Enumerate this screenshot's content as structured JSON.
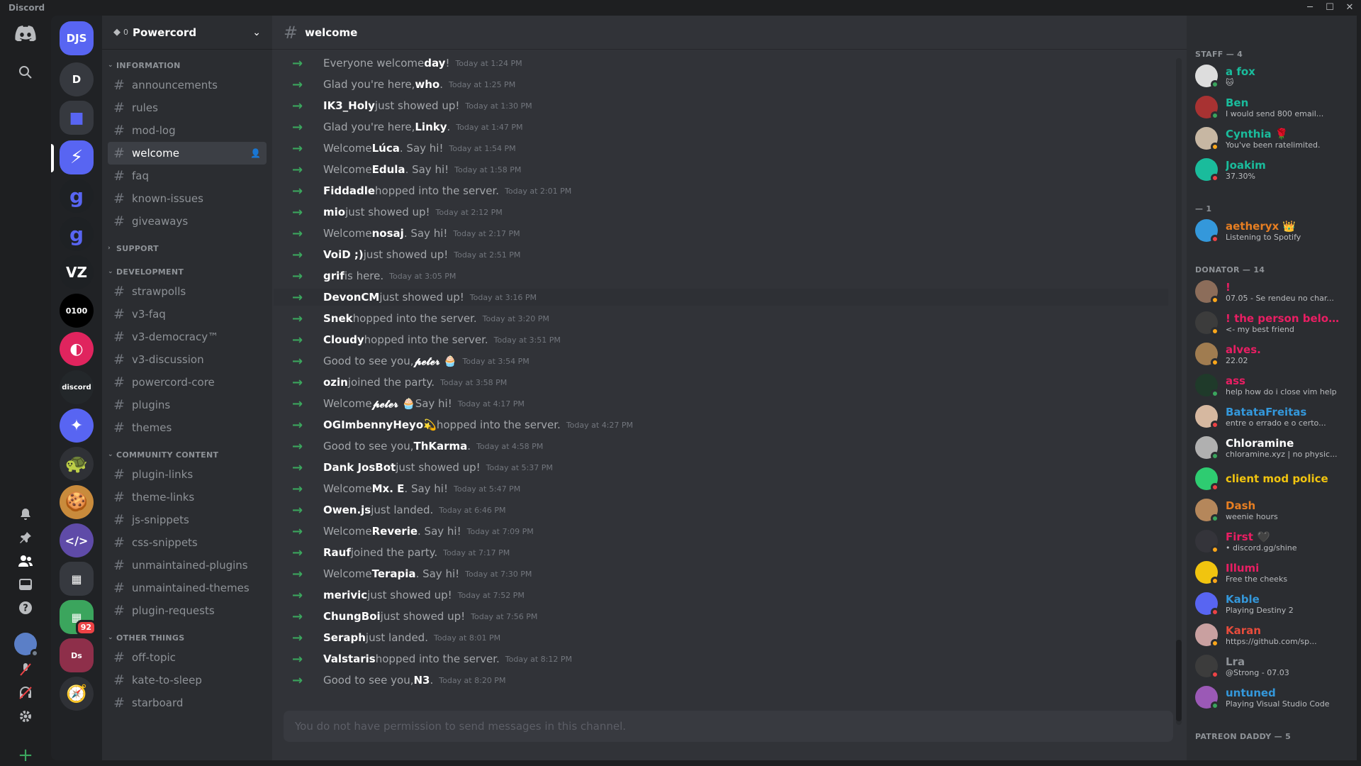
{
  "window": {
    "title": "Discord",
    "controls": [
      "─",
      "☐",
      "✕"
    ]
  },
  "guild": {
    "name": "Powercord",
    "boost_level": "0"
  },
  "servers": [
    {
      "label": "DJS",
      "color": "#5865f2"
    },
    {
      "label": "D",
      "color": "#36393f"
    },
    {
      "label": "",
      "color": "#36393f"
    },
    {
      "label": "",
      "color": "#5865f2"
    },
    {
      "label": "g",
      "color": "#1e2124"
    },
    {
      "label": "g",
      "color": "#1e2124"
    },
    {
      "label": "VZ",
      "color": "#1e2124"
    },
    {
      "label": "0100",
      "color": "#000000"
    },
    {
      "label": "",
      "color": "#e0245e"
    },
    {
      "label": "discord",
      "color": "#23272a"
    },
    {
      "label": "",
      "color": "#5865f2"
    },
    {
      "label": "",
      "color": "#2f3136"
    },
    {
      "label": "",
      "color": "#c98b3c"
    },
    {
      "label": "</>",
      "color": "#5f4ba8"
    },
    {
      "label": "",
      "color": "#36393f"
    },
    {
      "label": "",
      "color": "#3ba55d",
      "badge": "92"
    },
    {
      "label": "Ds",
      "color": "#8e2f4a"
    },
    {
      "label": "",
      "color": "#2f3136"
    }
  ],
  "categories": {
    "information": "INFORMATION",
    "support": "SUPPORT",
    "development": "DEVELOPMENT",
    "community": "COMMUNITY CONTENT",
    "other": "OTHER THINGS"
  },
  "channels": {
    "information": [
      "announcements",
      "rules",
      "mod-log",
      "welcome",
      "faq",
      "known-issues",
      "giveaways"
    ],
    "development": [
      "strawpolls",
      "v3-faq",
      "v3-democracy™",
      "v3-discussion",
      "powercord-core",
      "plugins",
      "themes"
    ],
    "community": [
      "plugin-links",
      "theme-links",
      "js-snippets",
      "css-snippets",
      "unmaintained-plugins",
      "unmaintained-themes",
      "plugin-requests"
    ],
    "other": [
      "off-topic",
      "kate-to-sleep",
      "starboard"
    ]
  },
  "chat": {
    "channel": "welcome",
    "composer_placeholder": "You do not have permission to send messages in this channel.",
    "messages": [
      {
        "before": "Everyone welcome ",
        "user": "day",
        "after": "!",
        "time": "Today at 1:24 PM"
      },
      {
        "before": "Glad you're here, ",
        "user": "who",
        "after": ".",
        "time": "Today at 1:25 PM"
      },
      {
        "before": "",
        "user": "IK3_Holy",
        "after": " just showed up!",
        "time": "Today at 1:30 PM"
      },
      {
        "before": "Glad you're here, ",
        "user": "Linky",
        "after": ".",
        "time": "Today at 1:47 PM"
      },
      {
        "before": "Welcome ",
        "user": "Lúca",
        "after": ". Say hi!",
        "time": "Today at 1:54 PM"
      },
      {
        "before": "Welcome ",
        "user": "Edula",
        "after": ". Say hi!",
        "time": "Today at 1:58 PM"
      },
      {
        "before": "",
        "user": "Fiddadle",
        "after": " hopped into the server.",
        "time": "Today at 2:01 PM"
      },
      {
        "before": "",
        "user": "mio",
        "after": " just showed up!",
        "time": "Today at 2:12 PM"
      },
      {
        "before": "Welcome ",
        "user": "nosaj",
        "after": ". Say hi!",
        "time": "Today at 2:17 PM"
      },
      {
        "before": "",
        "user": "VoiD ;)",
        "after": " just showed up!",
        "time": "Today at 2:51 PM"
      },
      {
        "before": "",
        "user": "grif",
        "after": " is here.",
        "time": "Today at 3:05 PM"
      },
      {
        "before": "",
        "user": "DevonCM",
        "after": " just showed up!",
        "time": "Today at 3:16 PM"
      },
      {
        "before": "",
        "user": "Snek",
        "after": " hopped into the server.",
        "time": "Today at 3:20 PM"
      },
      {
        "before": "",
        "user": "Cloudy",
        "after": " hopped into the server.",
        "time": "Today at 3:51 PM"
      },
      {
        "before": "Good to see you, ",
        "user": "𝓹𝓮𝓽𝓮𝓻 🧁",
        "after": "",
        "time": "Today at 3:54 PM"
      },
      {
        "before": "",
        "user": "ozin",
        "after": " joined the party.",
        "time": "Today at 3:58 PM"
      },
      {
        "before": "Welcome ",
        "user": "𝓹𝓮𝓽𝓮𝓻 🧁",
        "after": " Say hi!",
        "time": "Today at 4:17 PM"
      },
      {
        "before": "",
        "user": "OGImbennyHeyo💫",
        "after": "hopped into the server.",
        "time": "Today at 4:27 PM"
      },
      {
        "before": "Good to see you, ",
        "user": "ThKarma",
        "after": ".",
        "time": "Today at 4:58 PM"
      },
      {
        "before": "",
        "user": "Dank JosBot",
        "after": " just showed up!",
        "time": "Today at 5:37 PM"
      },
      {
        "before": "Welcome ",
        "user": "Mx. E",
        "after": ". Say hi!",
        "time": "Today at 5:47 PM"
      },
      {
        "before": "",
        "user": "Owen.js",
        "after": " just landed.",
        "time": "Today at 6:46 PM"
      },
      {
        "before": "Welcome ",
        "user": "Reverie",
        "after": ". Say hi!",
        "time": "Today at 7:09 PM"
      },
      {
        "before": "",
        "user": "Rauf",
        "after": " joined the party.",
        "time": "Today at 7:17 PM"
      },
      {
        "before": "Welcome ",
        "user": "Terapia",
        "after": ". Say hi!",
        "time": "Today at 7:30 PM"
      },
      {
        "before": "",
        "user": "merivic",
        "after": " just showed up!",
        "time": "Today at 7:52 PM"
      },
      {
        "before": "",
        "user": "ChungBoi",
        "after": " just showed up!",
        "time": "Today at 7:56 PM"
      },
      {
        "before": "",
        "user": "Seraph",
        "after": " just landed.",
        "time": "Today at 8:01 PM"
      },
      {
        "before": "",
        "user": "Valstaris",
        "after": " hopped into the server.",
        "time": "Today at 8:12 PM"
      },
      {
        "before": "Good to see you, ",
        "user": "N3",
        "after": ".",
        "time": "Today at 8:20 PM"
      }
    ]
  },
  "members": {
    "groups": [
      {
        "title": "STAFF — 4",
        "items": [
          {
            "name": "a fox",
            "status": "🐱",
            "color": "#1abc9c",
            "presence": "#3ba55d",
            "avatar": "#dddddd"
          },
          {
            "name": "Ben",
            "status": "I would send 800 email...",
            "color": "#1abc9c",
            "presence": "#3ba55d",
            "avatar": "#a83232"
          },
          {
            "name": "Cynthia 🌹",
            "status": "You've been ratelimited.",
            "color": "#1abc9c",
            "presence": "#faa61a",
            "avatar": "#c7b7a3"
          },
          {
            "name": "Joakim",
            "status": "37.30%",
            "color": "#1abc9c",
            "presence": "#ed4245",
            "avatar": "#1abc9c"
          }
        ]
      },
      {
        "title": "— 1",
        "items": [
          {
            "name": "aetheryx 👑",
            "status": "Listening to Spotify",
            "color": "#e67e22",
            "presence": "#ed4245",
            "avatar": "#3498db"
          }
        ]
      },
      {
        "title": "DONATOR — 14",
        "items": [
          {
            "name": "!",
            "status": "07.05 - Se rendeu no char...",
            "color": "#e91e63",
            "presence": "#faa61a",
            "avatar": "#8c6d5a"
          },
          {
            "name": "! the person below me ...",
            "status": "<- my best friend",
            "color": "#e91e63",
            "presence": "#faa61a",
            "avatar": "#3c3c3c"
          },
          {
            "name": "alves.",
            "status": "22.02",
            "color": "#e91e63",
            "presence": "#faa61a",
            "avatar": "#a07c50"
          },
          {
            "name": "ass",
            "status": "help how do i close vim help",
            "color": "#e91e63",
            "presence": "#3ba55d",
            "avatar": "#1f3a2a"
          },
          {
            "name": "BatataFreitas",
            "status": "entre o errado e o certo...",
            "color": "#3498db",
            "presence": "#ed4245",
            "avatar": "#d6b8a0"
          },
          {
            "name": "Chloramine",
            "status": "chloramine.xyz | no physic...",
            "color": "#ffffff",
            "presence": "#3ba55d",
            "avatar": "#b0b0b0"
          },
          {
            "name": "client mod police",
            "status": "",
            "color": "#f1c40f",
            "presence": "#ed4245",
            "avatar": "#2ecc71"
          },
          {
            "name": "Dash",
            "status": "weenie hours",
            "color": "#e67e22",
            "presence": "#3ba55d",
            "avatar": "#b5875b"
          },
          {
            "name": "First 🖤",
            "status": "• discord.gg/shine",
            "color": "#e91e63",
            "presence": "#faa61a",
            "avatar": "#34343a"
          },
          {
            "name": "Illumi",
            "status": "Free the cheeks",
            "color": "#e91e63",
            "presence": "#faa61a",
            "avatar": "#f1c40f"
          },
          {
            "name": "Kable",
            "status": "Playing Destiny 2",
            "color": "#3498db",
            "presence": "#ed4245",
            "avatar": "#5865f2"
          },
          {
            "name": "Karan",
            "status": "https://github.com/sp...",
            "color": "#e74c3c",
            "presence": "#faa61a",
            "avatar": "#c9a0a0"
          },
          {
            "name": "Lra",
            "status": "@Strong - 07.03",
            "color": "#8e9297",
            "presence": "#ed4245",
            "avatar": "#3c3c3c"
          },
          {
            "name": "untuned",
            "status": "Playing Visual Studio Code",
            "color": "#3498db",
            "presence": "#3ba55d",
            "avatar": "#9b59b6"
          }
        ]
      },
      {
        "title": "PATREON DADDY — 5",
        "items": []
      }
    ]
  }
}
